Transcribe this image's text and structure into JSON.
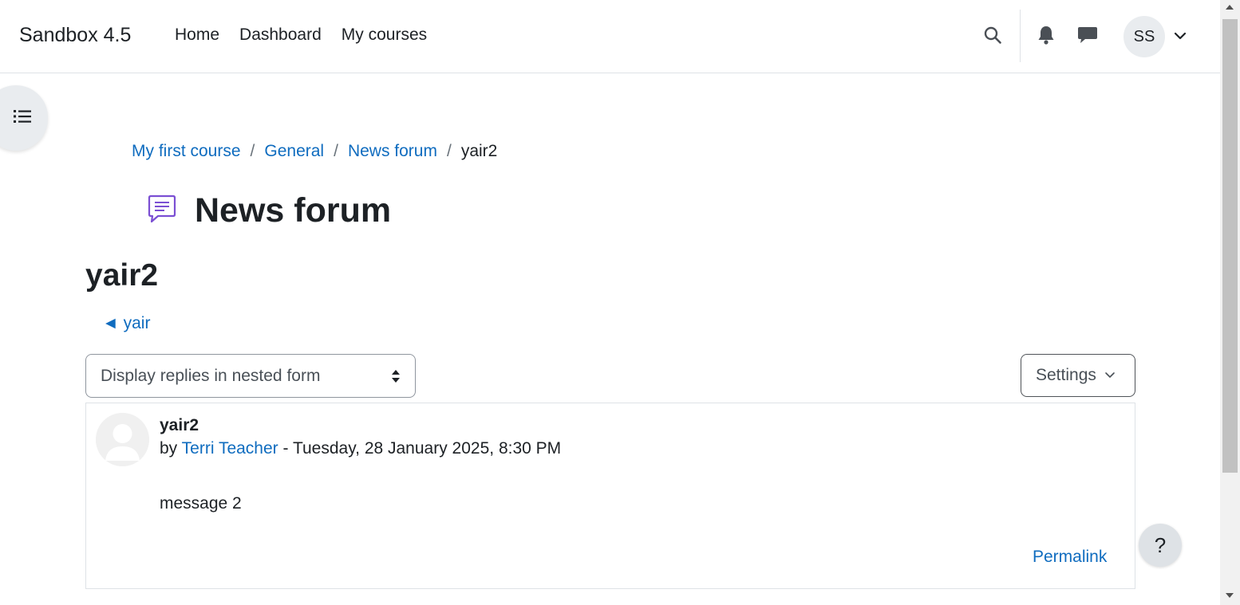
{
  "navbar": {
    "brand": "Sandbox 4.5",
    "links": [
      "Home",
      "Dashboard",
      "My courses"
    ],
    "user_initials": "SS",
    "icons": [
      "search-icon",
      "bell-icon",
      "messages-icon",
      "chevron-down-icon"
    ]
  },
  "breadcrumb": {
    "items": [
      "My first course",
      "General",
      "News forum"
    ],
    "current": "yair2",
    "separator": "/"
  },
  "page": {
    "title": "News forum",
    "icon": "forum-icon",
    "icon_color": "#7b4fd3"
  },
  "discussion": {
    "title": "yair2",
    "prev_link": "◄ yair"
  },
  "controls": {
    "display_mode": "Display replies in nested form",
    "settings_label": "Settings"
  },
  "post": {
    "subject": "yair2",
    "by_prefix": "by",
    "author": "Terri Teacher",
    "date": " - Tuesday, 28 January 2025, 8:30 PM",
    "message": "message 2",
    "permalink_label": "Permalink"
  },
  "help": {
    "label": "?"
  },
  "colors": {
    "link": "#0f6cbf",
    "text": "#1d2125"
  }
}
